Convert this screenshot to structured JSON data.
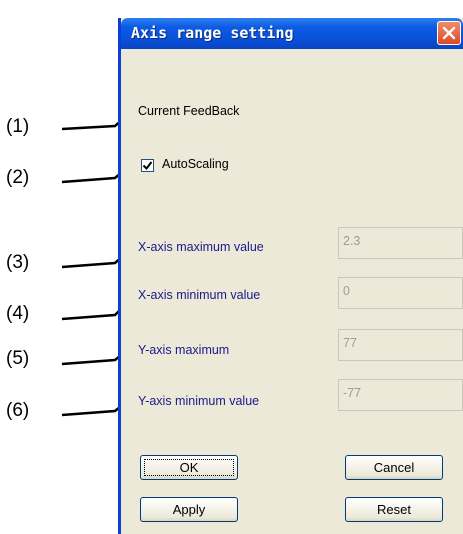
{
  "callouts": [
    "(1)",
    "(2)",
    "(3)",
    "(4)",
    "(5)",
    "(6)"
  ],
  "dialog": {
    "title": "Axis range setting",
    "close_icon": "close-icon",
    "section_label": "Current FeedBack",
    "autoscaling": {
      "label": "AutoScaling",
      "checked": true
    },
    "fields": [
      {
        "label": "X-axis maximum value",
        "value": "2.3"
      },
      {
        "label": "X-axis minimum value",
        "value": "0"
      },
      {
        "label": "Y-axis maximum",
        "value": "77"
      },
      {
        "label": "Y-axis minimum value",
        "value": "-77"
      }
    ],
    "buttons": {
      "ok": "OK",
      "cancel": "Cancel",
      "apply": "Apply",
      "reset": "Reset"
    }
  },
  "colors": {
    "titlebar": "#0850d8",
    "dialog_bg": "#ece9d8",
    "disabled_label": "#1a1a8c",
    "disabled_text": "#9d9d92"
  }
}
